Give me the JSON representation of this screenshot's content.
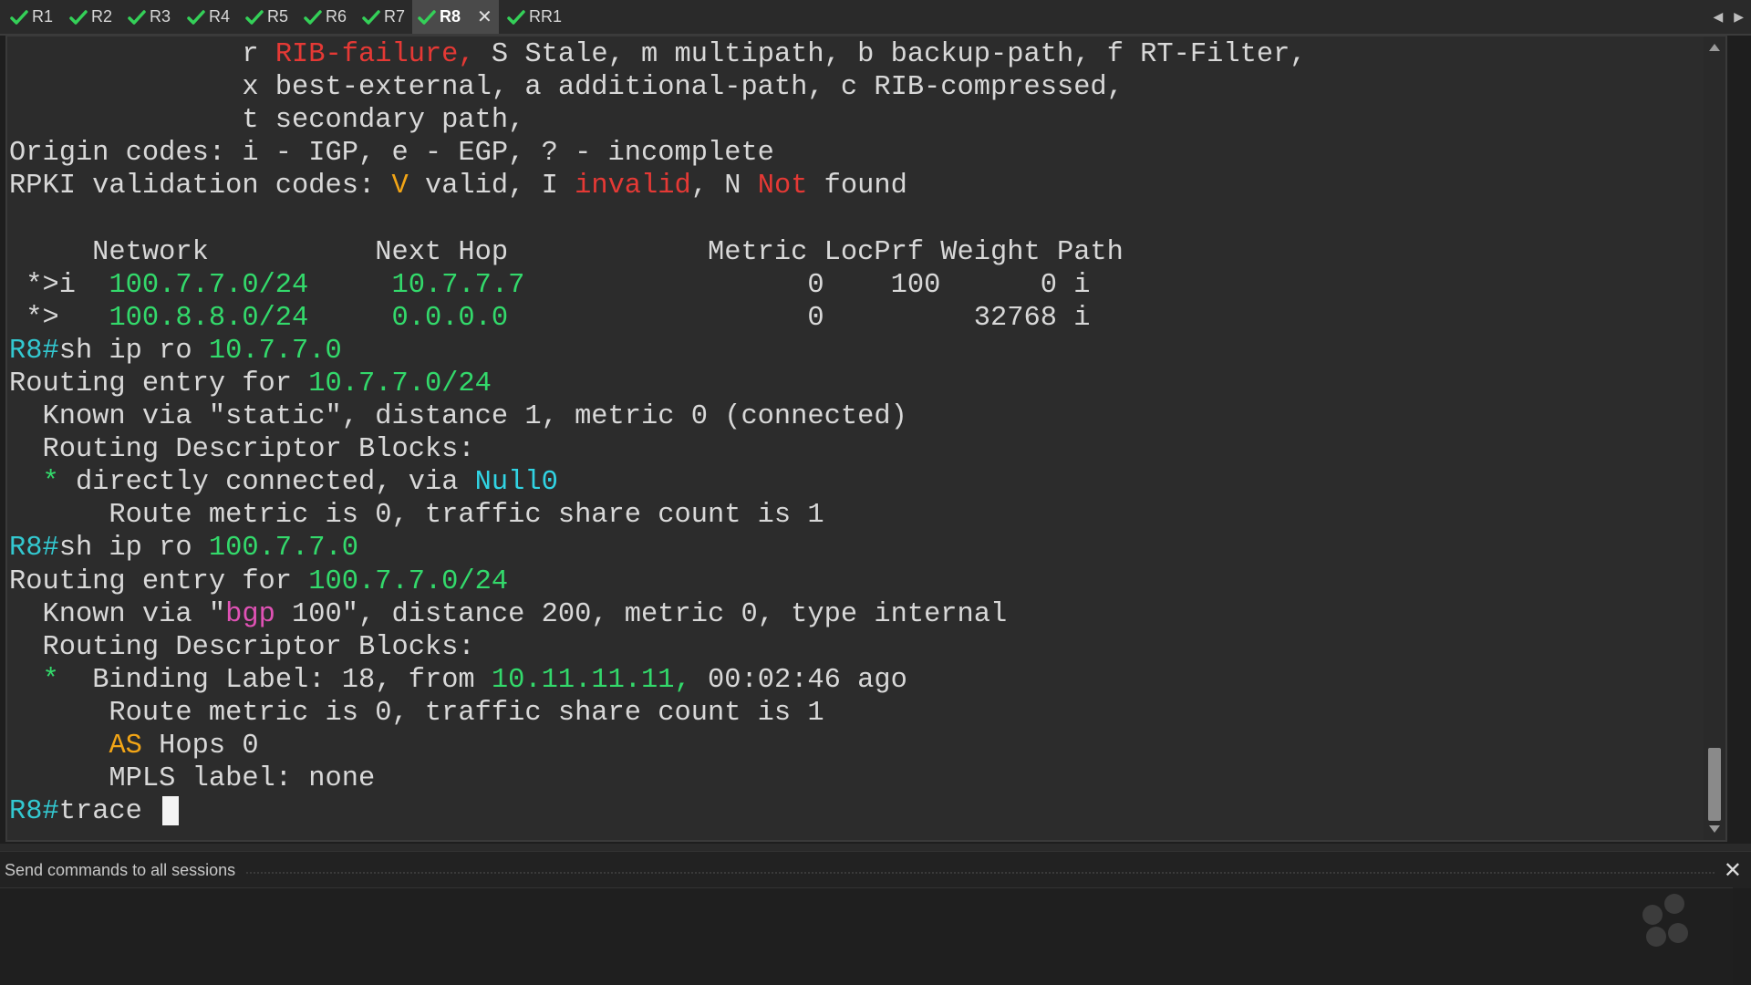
{
  "tabs": [
    {
      "label": "R1",
      "active": false
    },
    {
      "label": "R2",
      "active": false
    },
    {
      "label": "R3",
      "active": false
    },
    {
      "label": "R4",
      "active": false
    },
    {
      "label": "R5",
      "active": false
    },
    {
      "label": "R6",
      "active": false
    },
    {
      "label": "R7",
      "active": false
    },
    {
      "label": "R8",
      "active": true,
      "close": "✕"
    },
    {
      "label": "RR1",
      "active": false
    }
  ],
  "nav": {
    "prev": "◀",
    "next": "▶"
  },
  "colors": {
    "prompt": "#33c8d0",
    "green": "#33d96b",
    "red": "#e53935",
    "orange": "#f2a516",
    "magenta": "#e052b5",
    "cyan": "#31d3e3",
    "check": "#34d058"
  },
  "terminal": {
    "lines": [
      [
        {
          "t": "              r "
        },
        {
          "t": "RIB-failure,",
          "c": "red"
        },
        {
          "t": " S Stale, m multipath, b backup-path, f RT-Filter,"
        }
      ],
      [
        {
          "t": "              x best-external, a additional-path, c RIB-compressed,"
        }
      ],
      [
        {
          "t": "              t secondary path,"
        }
      ],
      [
        {
          "t": "Origin codes: i - IGP, e - EGP, ? - incomplete"
        }
      ],
      [
        {
          "t": "RPKI validation codes: "
        },
        {
          "t": "V",
          "c": "orange"
        },
        {
          "t": " valid, I "
        },
        {
          "t": "invalid",
          "c": "red"
        },
        {
          "t": ", N "
        },
        {
          "t": "Not",
          "c": "red"
        },
        {
          "t": " found"
        }
      ],
      [
        {
          "t": ""
        }
      ],
      [
        {
          "t": "     Network          Next Hop            Metric LocPrf Weight Path"
        }
      ],
      [
        {
          "t": " *>i  "
        },
        {
          "t": "100.7.7.0/24",
          "c": "green"
        },
        {
          "t": "     "
        },
        {
          "t": "10.7.7.7",
          "c": "green"
        },
        {
          "t": "                 0    100      0 i"
        }
      ],
      [
        {
          "t": " *>   "
        },
        {
          "t": "100.8.8.0/24",
          "c": "green"
        },
        {
          "t": "     "
        },
        {
          "t": "0.0.0.0",
          "c": "green"
        },
        {
          "t": "                  0         32768 i"
        }
      ],
      [
        {
          "t": "R8#",
          "c": "prompt"
        },
        {
          "t": "sh ip ro "
        },
        {
          "t": "10.7.7.0",
          "c": "green"
        }
      ],
      [
        {
          "t": "Routing entry for "
        },
        {
          "t": "10.7.7.0/24",
          "c": "green"
        }
      ],
      [
        {
          "t": "  Known via \"static\", distance 1, metric 0 (connected)"
        }
      ],
      [
        {
          "t": "  Routing Descriptor Blocks:"
        }
      ],
      [
        {
          "t": "  "
        },
        {
          "t": "*",
          "c": "green"
        },
        {
          "t": " directly connected, via "
        },
        {
          "t": "Null0",
          "c": "cyan"
        }
      ],
      [
        {
          "t": "      Route metric is 0, traffic share count is 1"
        }
      ],
      [
        {
          "t": "R8#",
          "c": "prompt"
        },
        {
          "t": "sh ip ro "
        },
        {
          "t": "100.7.7.0",
          "c": "green"
        }
      ],
      [
        {
          "t": "Routing entry for "
        },
        {
          "t": "100.7.7.0/24",
          "c": "green"
        }
      ],
      [
        {
          "t": "  Known via \""
        },
        {
          "t": "bgp",
          "c": "magenta"
        },
        {
          "t": " 100\", distance 200, metric 0, type internal"
        }
      ],
      [
        {
          "t": "  Routing Descriptor Blocks:"
        }
      ],
      [
        {
          "t": "  "
        },
        {
          "t": "*",
          "c": "green"
        },
        {
          "t": "  Binding Label: 18, from "
        },
        {
          "t": "10.11.11.11,",
          "c": "green"
        },
        {
          "t": " 00:02:46 ago"
        }
      ],
      [
        {
          "t": "      Route metric is 0, traffic share count is 1"
        }
      ],
      [
        {
          "t": "      "
        },
        {
          "t": "AS",
          "c": "orange"
        },
        {
          "t": " Hops 0"
        }
      ],
      [
        {
          "t": "      MPLS label: none"
        }
      ],
      [
        {
          "t": "R8#",
          "c": "prompt"
        },
        {
          "t": "trace "
        }
      ]
    ]
  },
  "send_panel": {
    "label": "Send commands to all sessions",
    "close": "✕"
  }
}
